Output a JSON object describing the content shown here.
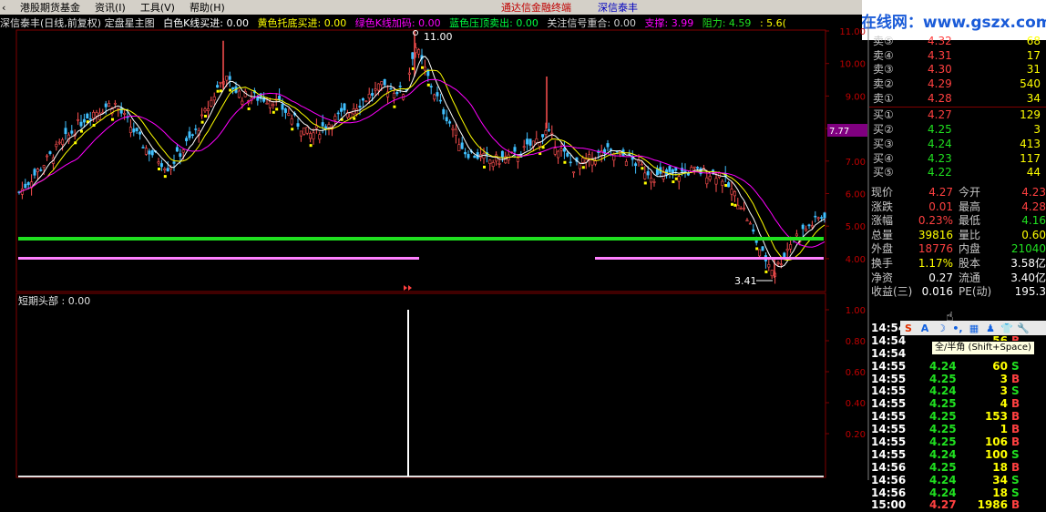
{
  "menu": {
    "items": [
      "港股期货基金",
      "资讯(I)",
      "工具(V)",
      "帮助(H)"
    ],
    "ticker_left": "通达信金融终端",
    "ticker_right": "深信泰丰"
  },
  "watermark": "公式在线网：www.gszx.com.cn",
  "info": {
    "title": "深信泰丰(日线,前复权) 定盘星主图",
    "white_k": "白色K线买进: 0.00",
    "yellow": "黄色托底买进: 0.00",
    "green_k": "绿色K线加码: 0.00",
    "blue": "蓝色压顶卖出: 0.00",
    "focus": "关注信号重合: 0.00",
    "support": "支撑: 3.99",
    "resistance": "阻力: 4.59",
    "tail": ": 5.6("
  },
  "chart": {
    "price_axis": [
      "11.00",
      "10.00",
      "9.00",
      "8.00",
      "7.00",
      "6.00",
      "5.00",
      "4.00"
    ],
    "current_tag": "7.77",
    "high_label": "11.00",
    "low_label": "3.41",
    "ind_title": "短期头部 : 0.00",
    "ind_axis": [
      "1.00",
      "0.80",
      "0.60",
      "0.40",
      "0.20"
    ],
    "colors": {
      "grid": "#800000",
      "ma1": "#ffffff",
      "ma2": "#ffff00",
      "ma3": "#ff00ff",
      "up": "#ff5050",
      "down": "#40c0ff",
      "support": "#20e020",
      "pink": "#ff80ff"
    }
  },
  "quote": {
    "sells": [
      {
        "label": "卖⑤",
        "price": "4.32",
        "vol": "68"
      },
      {
        "label": "卖④",
        "price": "4.31",
        "vol": "17"
      },
      {
        "label": "卖③",
        "price": "4.30",
        "vol": "31"
      },
      {
        "label": "卖②",
        "price": "4.29",
        "vol": "540"
      },
      {
        "label": "卖①",
        "price": "4.28",
        "vol": "34"
      }
    ],
    "buys": [
      {
        "label": "买①",
        "price": "4.27",
        "vol": "129"
      },
      {
        "label": "买②",
        "price": "4.25",
        "vol": "3"
      },
      {
        "label": "买③",
        "price": "4.24",
        "vol": "413"
      },
      {
        "label": "买④",
        "price": "4.23",
        "vol": "117"
      },
      {
        "label": "买⑤",
        "price": "4.22",
        "vol": "44"
      }
    ]
  },
  "stats": [
    {
      "k1": "现价",
      "v1": "4.27",
      "c1": "#ff4040",
      "k2": "今开",
      "v2": "4.23",
      "c2": "#ff4040"
    },
    {
      "k1": "涨跌",
      "v1": "0.01",
      "c1": "#ff4040",
      "k2": "最高",
      "v2": "4.28",
      "c2": "#ff4040"
    },
    {
      "k1": "涨幅",
      "v1": "0.23%",
      "c1": "#ff4040",
      "k2": "最低",
      "v2": "4.16",
      "c2": "#20e020"
    },
    {
      "k1": "总量",
      "v1": "39816",
      "c1": "#ffff00",
      "k2": "量比",
      "v2": "0.60",
      "c2": "#ffff00"
    },
    {
      "k1": "外盘",
      "v1": "18776",
      "c1": "#ff4040",
      "k2": "内盘",
      "v2": "21040",
      "c2": "#20e020"
    },
    {
      "k1": "换手",
      "v1": "1.17%",
      "c1": "#ffff00",
      "k2": "股本",
      "v2": "3.58亿",
      "c2": "#ffffff"
    },
    {
      "k1": "净资",
      "v1": "0.27",
      "c1": "#ffffff",
      "k2": "流通",
      "v2": "3.40亿",
      "c2": "#ffffff"
    },
    {
      "k1": "收益(三)",
      "v1": "0.016",
      "c1": "#ffffff",
      "k2": "PE(动)",
      "v2": "195.3",
      "c2": "#ffffff"
    }
  ],
  "ime": {
    "glyphs": [
      "S",
      "A",
      "☽",
      "•,",
      "▦",
      "♟",
      "👕",
      "🔧"
    ],
    "tooltip": "全/半角 (Shift+Space)"
  },
  "ticks": [
    {
      "time": "14:54",
      "price": "",
      "vol": "",
      "bs": "",
      "c": "#ffffff"
    },
    {
      "time": "14:54",
      "price": "",
      "vol": "56",
      "bs": "B",
      "c": "#20e020"
    },
    {
      "time": "14:54",
      "price": "",
      "vol": "",
      "bs": "",
      "c": "#ffffff"
    },
    {
      "time": "14:55",
      "price": "4.24",
      "vol": "60",
      "bs": "S",
      "c": "#20e020"
    },
    {
      "time": "14:55",
      "price": "4.25",
      "vol": "3",
      "bs": "B",
      "c": "#20e020"
    },
    {
      "time": "14:55",
      "price": "4.24",
      "vol": "3",
      "bs": "S",
      "c": "#20e020"
    },
    {
      "time": "14:55",
      "price": "4.25",
      "vol": "4",
      "bs": "B",
      "c": "#20e020"
    },
    {
      "time": "14:55",
      "price": "4.25",
      "vol": "153",
      "bs": "B",
      "c": "#20e020"
    },
    {
      "time": "14:55",
      "price": "4.25",
      "vol": "1",
      "bs": "B",
      "c": "#20e020"
    },
    {
      "time": "14:55",
      "price": "4.25",
      "vol": "106",
      "bs": "B",
      "c": "#20e020"
    },
    {
      "time": "14:55",
      "price": "4.24",
      "vol": "100",
      "bs": "S",
      "c": "#20e020"
    },
    {
      "time": "14:56",
      "price": "4.25",
      "vol": "18",
      "bs": "B",
      "c": "#20e020"
    },
    {
      "time": "14:56",
      "price": "4.24",
      "vol": "34",
      "bs": "S",
      "c": "#20e020"
    },
    {
      "time": "14:56",
      "price": "4.24",
      "vol": "18",
      "bs": "S",
      "c": "#20e020"
    },
    {
      "time": "15:00",
      "price": "4.27",
      "vol": "1986",
      "bs": "B",
      "c": "#ff4040"
    }
  ]
}
